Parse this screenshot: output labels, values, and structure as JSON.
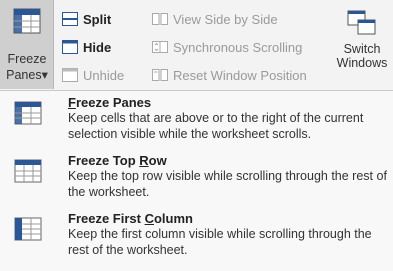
{
  "ribbon": {
    "freeze_panes": {
      "line1": "Freeze",
      "line2": "Panes",
      "dropdown_glyph": "▾"
    },
    "split": "Split",
    "hide": "Hide",
    "unhide": "Unhide",
    "view_side_by_side": "View Side by Side",
    "synchronous_scrolling": "Synchronous Scrolling",
    "reset_window_position": "Reset Window Position",
    "switch_windows": {
      "line1": "Switch",
      "line2": "Windows"
    }
  },
  "menu": {
    "items": [
      {
        "title_underline": "F",
        "title_rest": "reeze Panes",
        "description": "Keep cells that are above or to the right of the current selection visible while the worksheet scrolls.",
        "icon": "freeze-panes-icon"
      },
      {
        "title_before": "Freeze Top ",
        "title_underline": "R",
        "title_rest": "ow",
        "description": "Keep the top row visible while scrolling through the rest of the worksheet.",
        "icon": "freeze-top-row-icon"
      },
      {
        "title_before": "Freeze First ",
        "title_underline": "C",
        "title_rest": "olumn",
        "description": "Keep the first column visible while scrolling through the rest of the worksheet.",
        "icon": "freeze-first-column-icon"
      }
    ]
  },
  "colors": {
    "accent": "#2b5797",
    "active_button": "#cfcfcf",
    "menu_bg": "#f8f8f8"
  }
}
